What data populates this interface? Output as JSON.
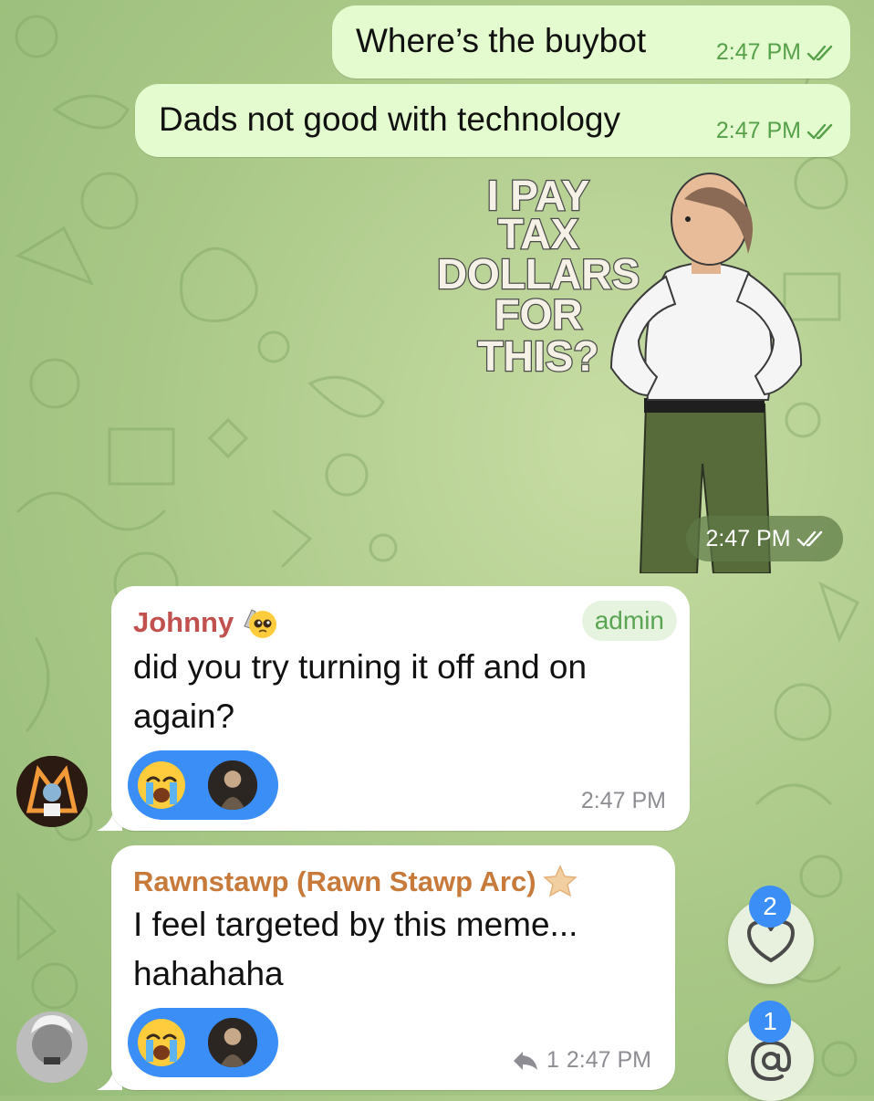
{
  "chat": {
    "outgoing": [
      {
        "text": "Where’s the buybot",
        "time": "2:47 PM"
      },
      {
        "text": "Dads not good with technology",
        "time": "2:47 PM"
      }
    ],
    "sticker": {
      "caption_lines": [
        "I PAY",
        "TAX",
        "DOLLARS",
        "FOR",
        "THIS?"
      ],
      "time": "2:47 PM"
    },
    "incoming": [
      {
        "sender": "Johnny",
        "sender_color": "#c0514f",
        "badge": "admin",
        "lines": [
          "did you try turning it off and on",
          "again?"
        ],
        "time": "2:47 PM"
      },
      {
        "sender": "Rawnstawp (Rawn Stawp Arc)",
        "sender_color": "#c77a3a",
        "lines": [
          "I feel targeted by this meme...",
          "hahahaha"
        ],
        "reply_count": "1",
        "time": "2:47 PM"
      }
    ]
  },
  "fabs": {
    "reactions_badge": "2",
    "mentions_badge": "1"
  },
  "colors": {
    "outgoing_bubble": "#e4fbcf",
    "incoming_bubble": "#ffffff",
    "accent_blue": "#3a8ef6",
    "time_green": "#56a04a"
  }
}
